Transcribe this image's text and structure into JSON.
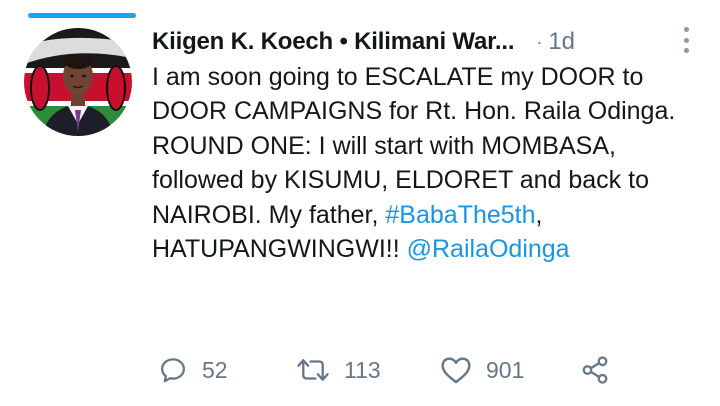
{
  "tweet": {
    "author_display": "Kiigen K. Koech • Kilimani War...",
    "separator": "·",
    "time": "1d",
    "text_parts": [
      "I am soon going to ESCALATE my DOOR to DOOR CAMPAIGNS for Rt. Hon. Raila Odinga. ROUND ONE: I will start with MOMBASA, followed by KISUMU, ELDORET and back to NAIROBI. My father, ",
      "#BabaThe5th",
      ", HATUPANGWINGWI!! ",
      "@RailaOdinga"
    ]
  },
  "actions": {
    "reply": {
      "icon": "reply-icon",
      "count": "52"
    },
    "retweet": {
      "icon": "retweet-icon",
      "count": "113"
    },
    "like": {
      "icon": "heart-icon",
      "count": "901"
    },
    "share": {
      "icon": "share-icon"
    }
  },
  "colors": {
    "accent": "#1da1f2",
    "link": "#1b95e0",
    "secondary_text": "#657786",
    "primary_text": "#14171a"
  }
}
